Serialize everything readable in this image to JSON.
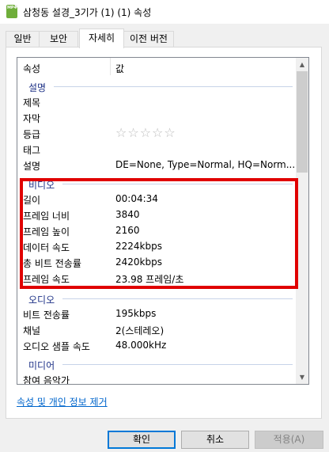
{
  "window": {
    "title": "삼청동 설경_3기가 (1) (1) 속성",
    "icon_label": "MP4"
  },
  "tabs": [
    {
      "label": "일반",
      "active": false
    },
    {
      "label": "보안",
      "active": false
    },
    {
      "label": "자세히",
      "active": true
    },
    {
      "label": "이전 버전",
      "active": false
    }
  ],
  "columns": {
    "property": "속성",
    "value": "값"
  },
  "groups": {
    "description": "설명",
    "video": "비디오",
    "audio": "오디오",
    "media": "미디어"
  },
  "description_rows": [
    {
      "key": "제목",
      "value": ""
    },
    {
      "key": "자막",
      "value": ""
    },
    {
      "key": "등급",
      "value": ""
    },
    {
      "key": "태그",
      "value": ""
    },
    {
      "key": "설명",
      "value": "DE=None, Type=Normal, HQ=Norm..."
    }
  ],
  "rating": {
    "stars": 0,
    "max": 5,
    "glyphs": "☆☆☆☆☆"
  },
  "video_rows": [
    {
      "key": "길이",
      "value": "00:04:34"
    },
    {
      "key": "프레임 너비",
      "value": "3840"
    },
    {
      "key": "프레임 높이",
      "value": "2160"
    },
    {
      "key": "데이터 속도",
      "value": "2224kbps"
    },
    {
      "key": "총 비트 전송률",
      "value": "2420kbps"
    },
    {
      "key": "프레임 속도",
      "value": "23.98 프레임/초"
    }
  ],
  "audio_rows": [
    {
      "key": "비트 전송률",
      "value": "195kbps"
    },
    {
      "key": "채널",
      "value": "2(스테레오)"
    },
    {
      "key": "오디오 샘플 속도",
      "value": "48.000kHz"
    }
  ],
  "media_rows": [
    {
      "key": "참여 음악가",
      "value": ""
    }
  ],
  "remove_link": "속성 및 개인 정보 제거",
  "buttons": {
    "ok": "확인",
    "cancel": "취소",
    "apply": "적용(A)"
  },
  "colors": {
    "highlight": "#e00000",
    "group_text": "#1e3287",
    "link": "#0066cc",
    "accent": "#0078d7"
  },
  "icons": {
    "scroll_up": "▲",
    "scroll_down": "▼"
  }
}
